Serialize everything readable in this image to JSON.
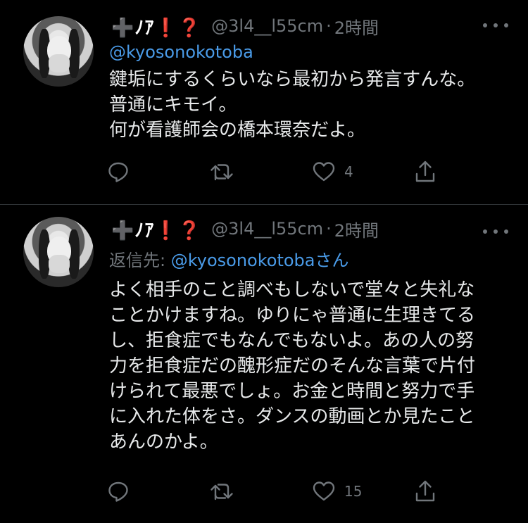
{
  "colors": {
    "background": "#000000",
    "text": "#e7e9ea",
    "muted": "#71767b",
    "link": "#4a9be8",
    "divider": "#2f3336"
  },
  "icons": {
    "reply": "speech-bubble-icon",
    "retweet": "retweet-icon",
    "like": "heart-icon",
    "share": "share-upload-icon",
    "more": "three-dots-icon"
  },
  "tweets": [
    {
      "display_name": "➕ﾉｱ❗️❓",
      "handle": "@3l4__l55cm",
      "separator": "·",
      "time": "2時間",
      "reply_prefix": "",
      "mention": "@kyosonokotoba",
      "mention_suffix": "",
      "text": "鍵垢にするくらいなら最初から発言すんな。\n普通にキモイ。\n何が看護師会の橋本環奈だよ。",
      "reply_count": "",
      "retweet_count": "",
      "like_count": "4"
    },
    {
      "display_name": "➕ﾉｱ❗️❓",
      "handle": "@3l4__l55cm",
      "separator": "·",
      "time": "2時間",
      "reply_prefix": "返信先: ",
      "mention": "@kyosonokotoba",
      "mention_suffix": "さん",
      "text": "よく相手のこと調べもしないで堂々と失礼な\nことかけますね。ゆりにゃ普通に生理きてる\nし、拒食症でもなんでもないよ。あの人の努\n力を拒食症だの醜形症だのそんな言葉で片付\nけられて最悪でしょ。お金と時間と努力で手\nに入れた体をさ。ダンスの動画とか見たこと\nあんのかよ。",
      "reply_count": "",
      "retweet_count": "",
      "like_count": "15"
    }
  ]
}
